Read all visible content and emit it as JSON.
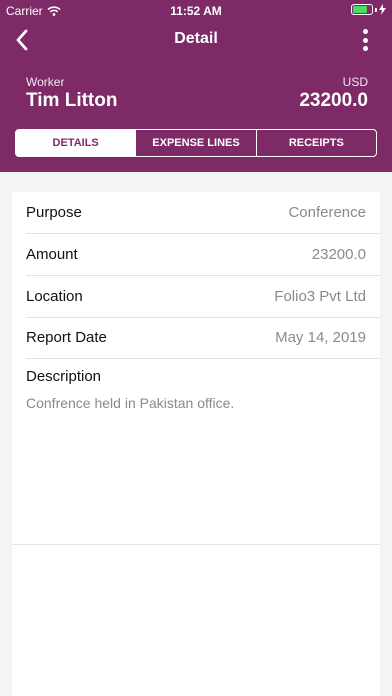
{
  "status_bar": {
    "carrier": "Carrier",
    "time": "11:52 AM"
  },
  "navbar": {
    "title": "Detail",
    "back_icon": "chevron-left-icon",
    "more_icon": "more-vertical-icon"
  },
  "summary": {
    "worker_label": "Worker",
    "worker_name": "Tim Litton",
    "currency": "USD",
    "total": "23200.0"
  },
  "tabs": [
    {
      "label": "DETAILS",
      "active": true
    },
    {
      "label": "EXPENSE LINES",
      "active": false
    },
    {
      "label": "RECEIPTS",
      "active": false
    }
  ],
  "details": {
    "rows": [
      {
        "label": "Purpose",
        "value": "Conference"
      },
      {
        "label": "Amount",
        "value": "23200.0"
      },
      {
        "label": "Location",
        "value": "Folio3 Pvt Ltd"
      },
      {
        "label": "Report Date",
        "value": "May 14, 2019"
      }
    ],
    "description_label": "Description",
    "description_text": "Confrence held in Pakistan office."
  },
  "colors": {
    "brand": "#7d2a66",
    "battery": "#4cd964",
    "muted_text": "#8a8a8a"
  }
}
